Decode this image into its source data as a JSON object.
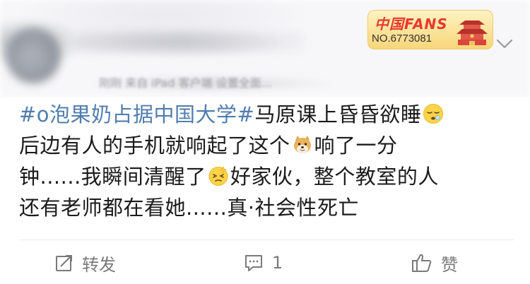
{
  "header": {
    "meta_text": "刚刚  来自 iPad 客户端 设置全面...",
    "fans_badge": {
      "title": "中国FANS",
      "number": "NO.6773081"
    }
  },
  "post": {
    "lines": [
      {
        "hashtag": "#o泡果奶占据中国大学#",
        "text": "马原课上昏昏欲睡"
      },
      {
        "text_a": "后边有人的手机就响起了这个",
        "text_b": "响了一分"
      },
      {
        "text_a": "钟......我瞬间清醒了",
        "text_b": "好家伙，整个教室的人"
      },
      {
        "text": "还有老师都在看她......真·社会性死亡"
      }
    ],
    "emojis": [
      "sleepy-face-emoji",
      "doge-emoji",
      "dizzy-face-emoji"
    ]
  },
  "actions": {
    "repost_label": "转发",
    "comment_count": "1",
    "like_label": "赞"
  },
  "colors": {
    "hashtag": "#507daf",
    "text": "#1b1b1b",
    "action": "#7a7a7a",
    "badge_red": "#e73a2e"
  }
}
